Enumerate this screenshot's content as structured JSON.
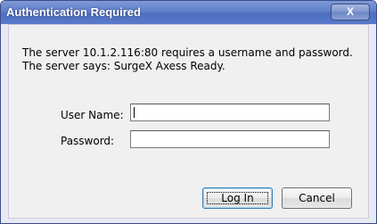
{
  "dialog": {
    "title": "Authentication Required",
    "close_label": "X"
  },
  "message": {
    "line1": "The server 10.1.2.116:80 requires a username and password.",
    "line2": "The server says: SurgeX Axess Ready."
  },
  "form": {
    "username_label": "User Name:",
    "username_value": "",
    "password_label": "Password:",
    "password_value": ""
  },
  "buttons": {
    "login_label": "Log In",
    "cancel_label": "Cancel"
  }
}
